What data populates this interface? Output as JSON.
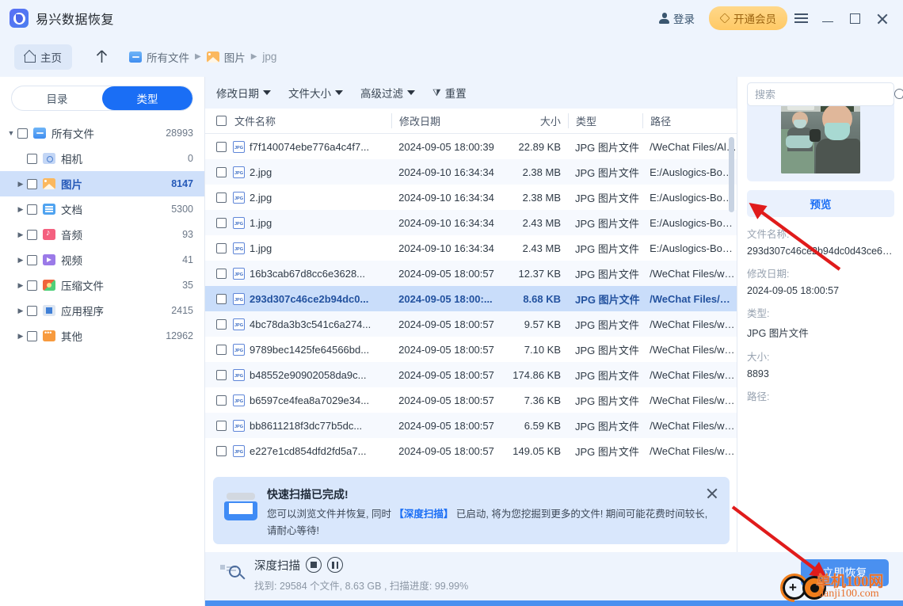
{
  "window": {
    "app_title": "易兴数据恢复",
    "login_label": "登录",
    "vip_label": "开通会员",
    "menu_icon": "hamburger-icon",
    "minimize_icon": "minimize-icon",
    "maximize_icon": "maximize-icon",
    "close_icon": "close-icon"
  },
  "breadcrumb": {
    "home_label": "主页",
    "up_label": "↑",
    "items": [
      {
        "label": "所有文件",
        "icon": "folder-icon"
      },
      {
        "label": "图片",
        "icon": "image-icon"
      },
      {
        "label": "jpg",
        "icon": ""
      }
    ],
    "separator": "▶"
  },
  "sidebar": {
    "tabs": [
      {
        "label": "目录",
        "active": false
      },
      {
        "label": "类型",
        "active": true
      }
    ],
    "tree": [
      {
        "label": "所有文件",
        "count": "28993",
        "icon": "folder-icon",
        "indent": 0,
        "caret": "▼",
        "selected": false
      },
      {
        "label": "相机",
        "count": "0",
        "icon": "camera-icon",
        "indent": 1,
        "caret": "",
        "selected": false
      },
      {
        "label": "图片",
        "count": "8147",
        "icon": "image-icon",
        "indent": 1,
        "caret": "▶",
        "selected": true
      },
      {
        "label": "文档",
        "count": "5300",
        "icon": "doc-icon",
        "indent": 1,
        "caret": "▶",
        "selected": false
      },
      {
        "label": "音频",
        "count": "93",
        "icon": "audio-icon",
        "indent": 1,
        "caret": "▶",
        "selected": false
      },
      {
        "label": "视频",
        "count": "41",
        "icon": "video-icon",
        "indent": 1,
        "caret": "▶",
        "selected": false
      },
      {
        "label": "压缩文件",
        "count": "35",
        "icon": "archive-icon",
        "indent": 1,
        "caret": "▶",
        "selected": false
      },
      {
        "label": "应用程序",
        "count": "2415",
        "icon": "app-icon",
        "indent": 1,
        "caret": "▶",
        "selected": false
      },
      {
        "label": "其他",
        "count": "12962",
        "icon": "other-icon",
        "indent": 1,
        "caret": "▶",
        "selected": false
      }
    ]
  },
  "filterbar": {
    "items": [
      {
        "label": "修改日期",
        "dropdown": true
      },
      {
        "label": "文件大小",
        "dropdown": true
      },
      {
        "label": "高级过滤",
        "dropdown": true
      }
    ],
    "reset_label": "重置",
    "reset_icon": "filter-reset-icon"
  },
  "search": {
    "placeholder": "搜索",
    "value": "",
    "icon": "search-icon"
  },
  "table": {
    "columns": [
      "文件名称",
      "修改日期",
      "大小",
      "类型",
      "路径"
    ],
    "rows": [
      {
        "name": "f7f140074ebe776a4c4f7...",
        "date": "2024-09-05 18:00:39",
        "size": "22.89 KB",
        "type": "JPG 图片文件",
        "path": "/WeChat Files/All ...",
        "selected": false
      },
      {
        "name": "2.jpg",
        "date": "2024-09-10 16:34:34",
        "size": "2.38 MB",
        "type": "JPG 图片文件",
        "path": "E:/Auslogics-Boos...",
        "selected": false
      },
      {
        "name": "2.jpg",
        "date": "2024-09-10 16:34:34",
        "size": "2.38 MB",
        "type": "JPG 图片文件",
        "path": "E:/Auslogics-Boos...",
        "selected": false
      },
      {
        "name": "1.jpg",
        "date": "2024-09-10 16:34:34",
        "size": "2.43 MB",
        "type": "JPG 图片文件",
        "path": "E:/Auslogics-Boos...",
        "selected": false
      },
      {
        "name": "1.jpg",
        "date": "2024-09-10 16:34:34",
        "size": "2.43 MB",
        "type": "JPG 图片文件",
        "path": "E:/Auslogics-Boos...",
        "selected": false
      },
      {
        "name": "16b3cab67d8cc6e3628...",
        "date": "2024-09-05 18:00:57",
        "size": "12.37 KB",
        "type": "JPG 图片文件",
        "path": "/WeChat Files/wxi...",
        "selected": false
      },
      {
        "name": "293d307c46ce2b94dc0...",
        "date": "2024-09-05 18:00:...",
        "size": "8.68 KB",
        "type": "JPG 图片文件",
        "path": "/WeChat Files/wx...",
        "selected": true
      },
      {
        "name": "4bc78da3b3c541c6a274...",
        "date": "2024-09-05 18:00:57",
        "size": "9.57 KB",
        "type": "JPG 图片文件",
        "path": "/WeChat Files/wxi...",
        "selected": false
      },
      {
        "name": "9789bec1425fe64566bd...",
        "date": "2024-09-05 18:00:57",
        "size": "7.10 KB",
        "type": "JPG 图片文件",
        "path": "/WeChat Files/wxi...",
        "selected": false
      },
      {
        "name": "b48552e90902058da9c...",
        "date": "2024-09-05 18:00:57",
        "size": "174.86 KB",
        "type": "JPG 图片文件",
        "path": "/WeChat Files/wxi...",
        "selected": false
      },
      {
        "name": "b6597ce4fea8a7029e34...",
        "date": "2024-09-05 18:00:57",
        "size": "7.36 KB",
        "type": "JPG 图片文件",
        "path": "/WeChat Files/wxi...",
        "selected": false
      },
      {
        "name": "bb8611218f3dc77b5dc...",
        "date": "2024-09-05 18:00:57",
        "size": "6.59 KB",
        "type": "JPG 图片文件",
        "path": "/WeChat Files/wxi...",
        "selected": false
      },
      {
        "name": "e227e1cd854dfd2fd5a7...",
        "date": "2024-09-05 18:00:57",
        "size": "149.05 KB",
        "type": "JPG 图片文件",
        "path": "/WeChat Files/wxi...",
        "selected": false
      }
    ]
  },
  "notice": {
    "title": "快速扫描已完成!",
    "body_before": "您可以浏览文件并恢复, 同时 ",
    "body_link": "【深度扫描】",
    "body_after": " 已启动, 将为您挖掘到更多的文件! 期间可能花费时间较长, 请耐心等待!",
    "close_icon": "close-icon",
    "icon": "scanner-icon"
  },
  "detail": {
    "preview_label": "预览",
    "thumbnail_alt": "jpg-thumbnail",
    "fields": [
      {
        "label": "文件名称:",
        "value": "293d307c46ce2b94dc0d43ce6e..."
      },
      {
        "label": "修改日期:",
        "value": "2024-09-05 18:00:57"
      },
      {
        "label": "类型:",
        "value": "JPG 图片文件"
      },
      {
        "label": "大小:",
        "value": "8893"
      },
      {
        "label": "路径:",
        "value": ""
      }
    ]
  },
  "bottom": {
    "scan_title": "深度扫描",
    "stop_icon": "stop-icon",
    "pause_icon": "pause-icon",
    "status": "找到: 29584 个文件, 8.63 GB , 扫描进度: 99.99%",
    "recover_label": "立即恢复",
    "progress_percent": "99.99%"
  },
  "watermark": {
    "title": "单机100网",
    "subtitle": "danji100.com"
  },
  "colors": {
    "accent": "#1a6ef5",
    "header_bg": "#eef4fd",
    "selected_row": "#c9ddfa",
    "vip": "#ffc965",
    "arrow": "#e01b1b",
    "progress": "#4a90f0"
  }
}
